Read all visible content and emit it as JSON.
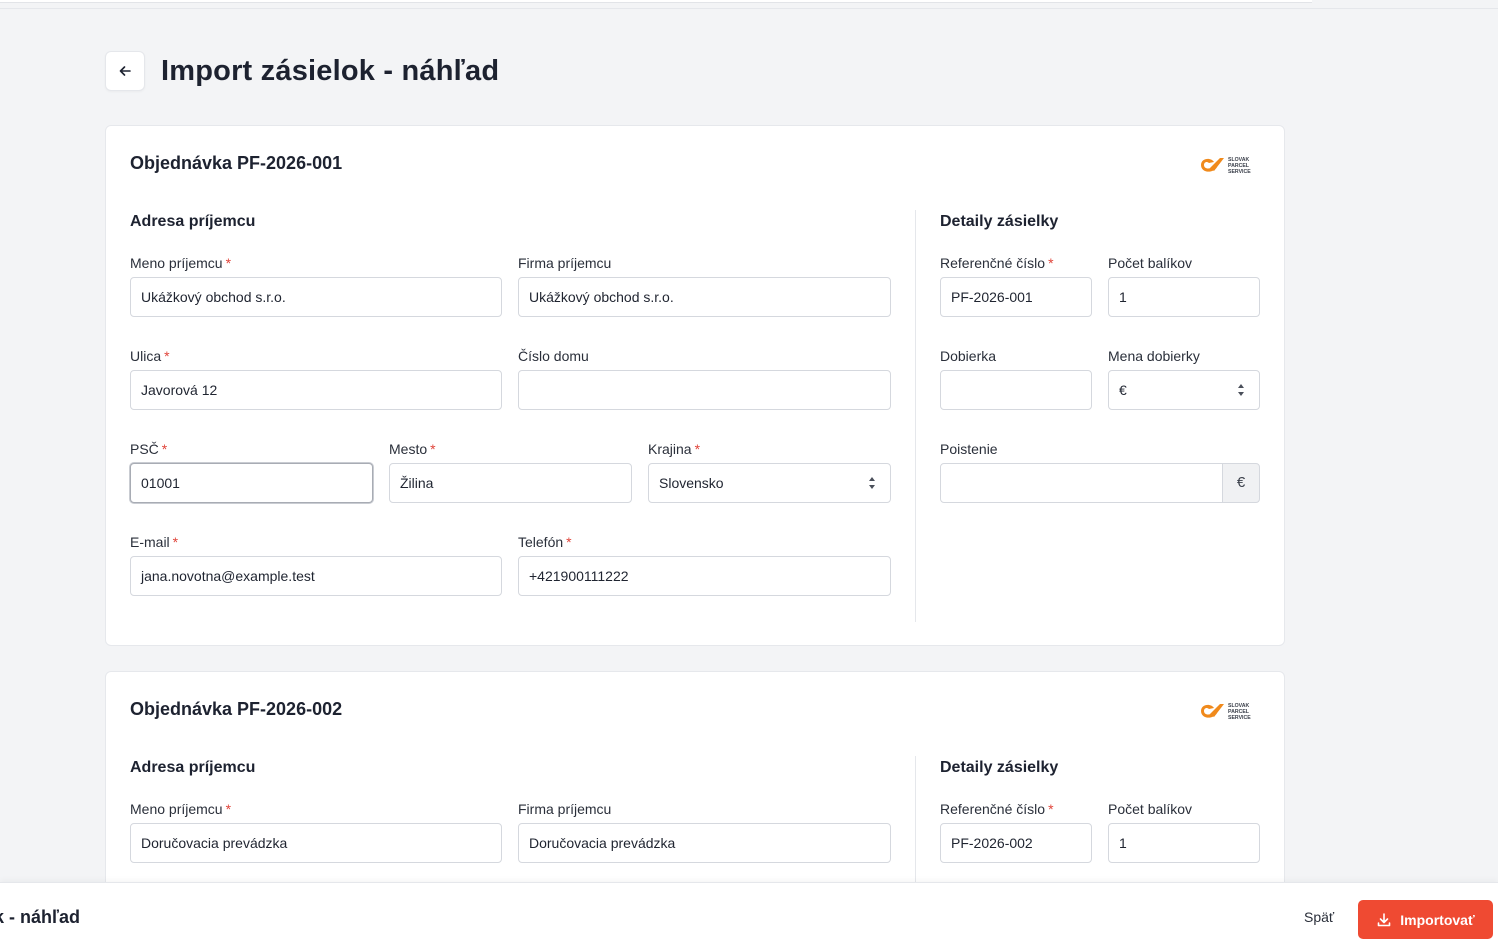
{
  "page": {
    "title": "Import zásielok - náhľad"
  },
  "orders": [
    {
      "title": "Objednávka PF-2026-001",
      "recipient_section": "Adresa príjemcu",
      "details_section": "Detaily zásielky",
      "fields": {
        "meno": {
          "label": "Meno príjemcu",
          "value": "Ukážkový obchod s.r.o."
        },
        "firma": {
          "label": "Firma príjemcu",
          "value": "Ukážkový obchod s.r.o."
        },
        "ulica": {
          "label": "Ulica",
          "value": "Javorová 12"
        },
        "cislo_domu": {
          "label": "Číslo domu",
          "value": ""
        },
        "psc": {
          "label": "PSČ",
          "value": "01001"
        },
        "mesto": {
          "label": "Mesto",
          "value": "Žilina"
        },
        "krajina": {
          "label": "Krajina",
          "value": "Slovensko"
        },
        "email": {
          "label": "E-mail",
          "value": "jana.novotna@example.test"
        },
        "telefon": {
          "label": "Telefón",
          "value": "+421900111222"
        },
        "referencne": {
          "label": "Referenčné číslo",
          "value": "PF-2026-001"
        },
        "pocet": {
          "label": "Počet balíkov",
          "value": "1"
        },
        "dobierka": {
          "label": "Dobierka",
          "value": ""
        },
        "mena": {
          "label": "Mena dobierky",
          "value": "€"
        },
        "poistenie": {
          "label": "Poistenie",
          "value": "",
          "addon": "€"
        }
      }
    },
    {
      "title": "Objednávka PF-2026-002",
      "recipient_section": "Adresa príjemcu",
      "details_section": "Detaily zásielky",
      "fields": {
        "meno": {
          "label": "Meno príjemcu",
          "value": "Doručovacia prevádzka"
        },
        "firma": {
          "label": "Firma príjemcu",
          "value": "Doručovacia prevádzka"
        },
        "referencne": {
          "label": "Referenčné číslo",
          "value": "PF-2026-002"
        },
        "pocet": {
          "label": "Počet balíkov",
          "value": "1"
        }
      }
    }
  ],
  "carrier_logo": {
    "text": [
      "SLOVAK",
      "PARCEL",
      "SERVICE"
    ],
    "brand_color": "#f08a1c"
  },
  "footer": {
    "title": "elok - náhľad",
    "back_label": "Späť",
    "import_label": "Importovať"
  },
  "colors": {
    "accent": "#ef4a32",
    "required": "#e0443a"
  }
}
